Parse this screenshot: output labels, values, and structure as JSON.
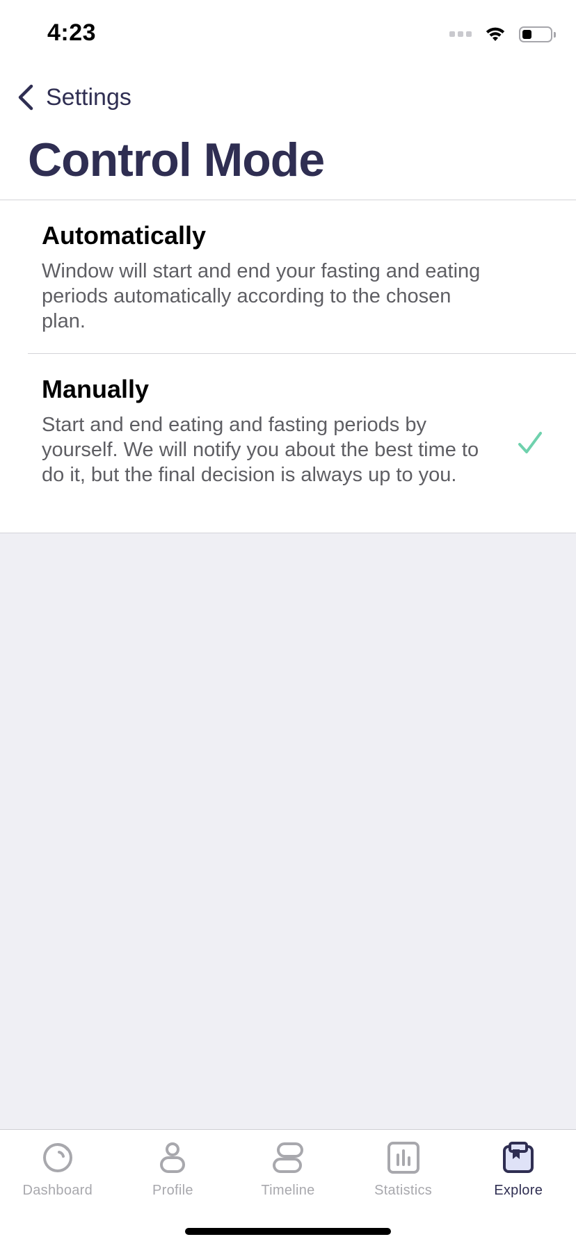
{
  "status_bar": {
    "time": "4:23",
    "battery_level": 0.35
  },
  "nav": {
    "back_label": "Settings",
    "title": "Control Mode"
  },
  "options": [
    {
      "title": "Automatically",
      "description": "Window will start and end your fasting and eating periods automatically according to the chosen plan.",
      "selected": false
    },
    {
      "title": "Manually",
      "description": "Start and end eating and fasting periods by yourself. We will notify you about the best time to do it, but the final decision is always up to you.",
      "selected": true
    }
  ],
  "tab_bar": {
    "tabs": [
      {
        "label": "Dashboard",
        "icon": "dashboard-icon",
        "active": false
      },
      {
        "label": "Profile",
        "icon": "profile-icon",
        "active": false
      },
      {
        "label": "Timeline",
        "icon": "timeline-icon",
        "active": false
      },
      {
        "label": "Statistics",
        "icon": "statistics-icon",
        "active": false
      },
      {
        "label": "Explore",
        "icon": "explore-icon",
        "active": true
      }
    ]
  },
  "colors": {
    "primary": "#2f2e52",
    "check": "#6fd1ad",
    "inactive": "#a8a8ad",
    "background": "#efeff4",
    "explore_fill": "#dfe2f7"
  }
}
